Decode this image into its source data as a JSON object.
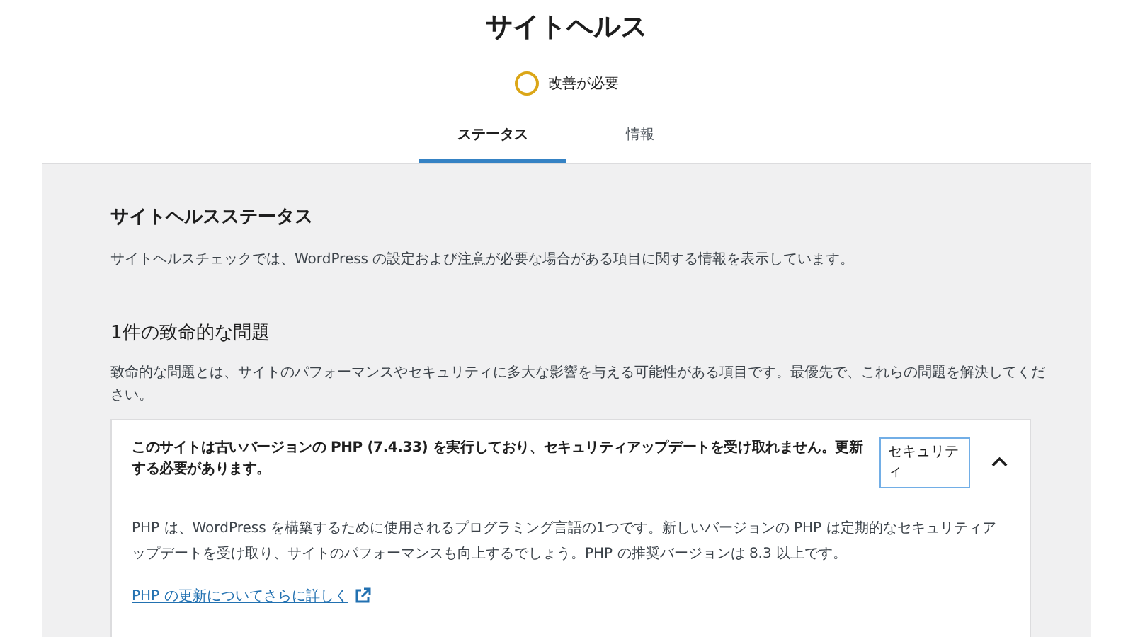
{
  "header": {
    "title": "サイトヘルス",
    "status": {
      "label": "改善が必要",
      "color": "#dba617"
    }
  },
  "tabs": [
    {
      "label": "ステータス",
      "selected": true
    },
    {
      "label": "情報",
      "selected": false
    }
  ],
  "panel": {
    "title": "サイトヘルスステータス",
    "description": "サイトヘルスチェックでは、WordPress の設定および注意が必要な場合がある項目に関する情報を表示しています。",
    "critical": {
      "heading": "1件の致命的な問題",
      "description": "致命的な問題とは、サイトのパフォーマンスやセキュリティに多大な影響を与える可能性がある項目です。最優先で、これらの問題を解決してください。",
      "issues": [
        {
          "title": "このサイトは古いバージョンの PHP (7.4.33) を実行しており、セキュリティアップデートを受け取れません。更新する必要があります。",
          "badge": "セキュリティ",
          "expanded": true,
          "body": "PHP は、WordPress を構築するために使用されるプログラミング言語の1つです。新しいバージョンの PHP は定期的なセキュリティアップデートを受け取り、サイトのパフォーマンスも向上するでしょう。PHP の推奨バージョンは 8.3 以上です。",
          "link": "PHP の更新についてさらに詳しく"
        }
      ]
    }
  }
}
